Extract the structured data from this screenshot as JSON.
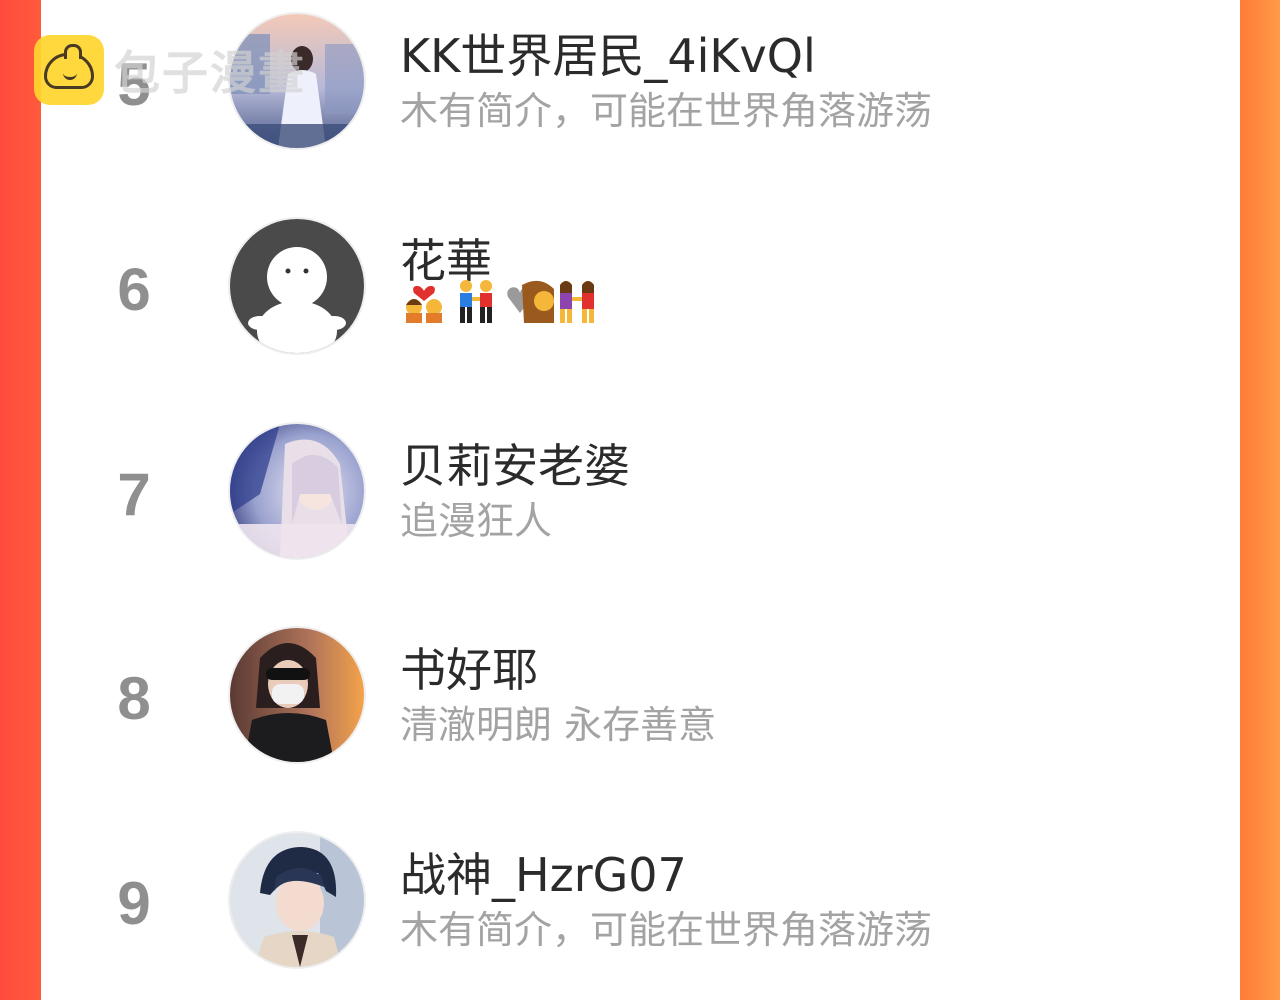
{
  "watermark": {
    "text": "包子漫畫"
  },
  "ranking": [
    {
      "rank": "5",
      "name": "KK世界居民_4iKvQl",
      "bio": "木有简介，可能在世界角落游荡"
    },
    {
      "rank": "6",
      "name": "花華",
      "bio": ""
    },
    {
      "rank": "7",
      "name": "贝莉安老婆",
      "bio": "追漫狂人"
    },
    {
      "rank": "8",
      "name": "书好耶",
      "bio": "清澈明朗 永存善意"
    },
    {
      "rank": "9",
      "name": "战神_HzrG07",
      "bio": "木有简介，可能在世界角落游荡"
    }
  ],
  "colors": {
    "left_edge": "#ff4b3e",
    "right_edge": "#ff8a3d",
    "rank_text": "#8f8f8f",
    "name_text": "#2b2b2b",
    "bio_text": "#a3a3a3",
    "watermark_logo": "#ffd52e"
  },
  "icons": [
    "bun-logo-icon",
    "couple-with-heart-icon",
    "holding-hands-icon",
    "heart-icon",
    "women-holding-hands-icon"
  ]
}
